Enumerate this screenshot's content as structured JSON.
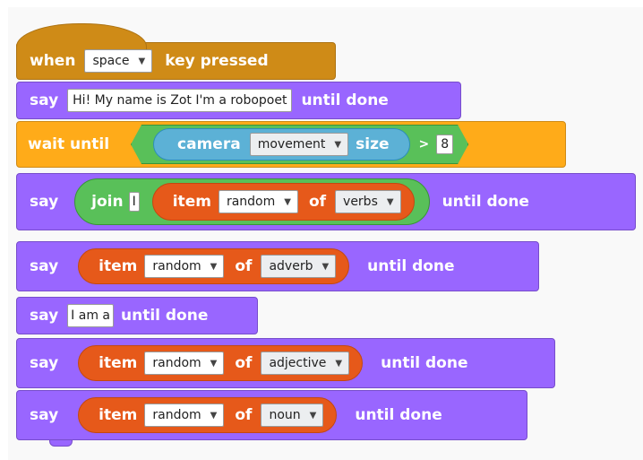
{
  "blocks": {
    "when": {
      "prefix": "when",
      "key": "space",
      "suffix": "key pressed"
    },
    "say1": {
      "say": "say",
      "text": "Hi! My name is Zot I'm a robopoet",
      "until": "until done"
    },
    "wait": {
      "label": "wait until",
      "camera": "camera",
      "attribute": "movement",
      "size": "size",
      "op": ">",
      "value": "8"
    },
    "say2": {
      "say": "say",
      "join": "join",
      "join_text": "I",
      "item": "item",
      "index": "random",
      "of": "of",
      "list": "verbs",
      "until": "until done"
    },
    "say3": {
      "say": "say",
      "item": "item",
      "index": "random",
      "of": "of",
      "list": "adverb",
      "until": "until done"
    },
    "say4": {
      "say": "say",
      "text": "I am a",
      "until": "until done"
    },
    "say5": {
      "say": "say",
      "item": "item",
      "index": "random",
      "of": "of",
      "list": "adjective",
      "until": "until done"
    },
    "say6": {
      "say": "say",
      "item": "item",
      "index": "random",
      "of": "of",
      "list": "noun",
      "until": "until done"
    }
  },
  "colors": {
    "event": "#cf8b17",
    "looks": "#9966ff",
    "control": "#ffab19",
    "data_list": "#e6591a",
    "operator": "#59c059",
    "sensing": "#5cb1d6"
  },
  "icons": {
    "dropdown": "chevron-down-icon"
  }
}
